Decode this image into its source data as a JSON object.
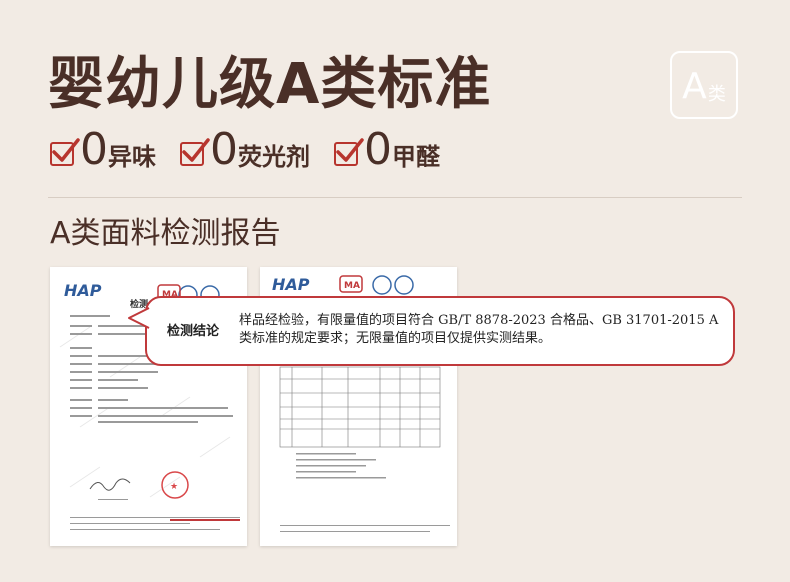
{
  "header": {
    "title": "婴幼儿级A类标准",
    "badge_big": "A",
    "badge_small": "类"
  },
  "features": [
    {
      "num": "0",
      "label": "异味"
    },
    {
      "num": "0",
      "label": "荧光剂"
    },
    {
      "num": "0",
      "label": "甲醛"
    }
  ],
  "section": {
    "title": "A类面料检测报告"
  },
  "report": {
    "doc1_logo": "HAP",
    "doc2_logo": "HAP",
    "doc1_heading": "检测",
    "conclusion_label": "检测结论",
    "conclusion_text": "样品经检验，有限量值的项目符合 GB/T 8878-2023 合格品、GB 31701-2015 A 类标准的规定要求；无限量值的项目仅提供实测结果。"
  },
  "colors": {
    "accent": "#c0393b",
    "title": "#4a2f27",
    "background": "#f2ebe4"
  }
}
